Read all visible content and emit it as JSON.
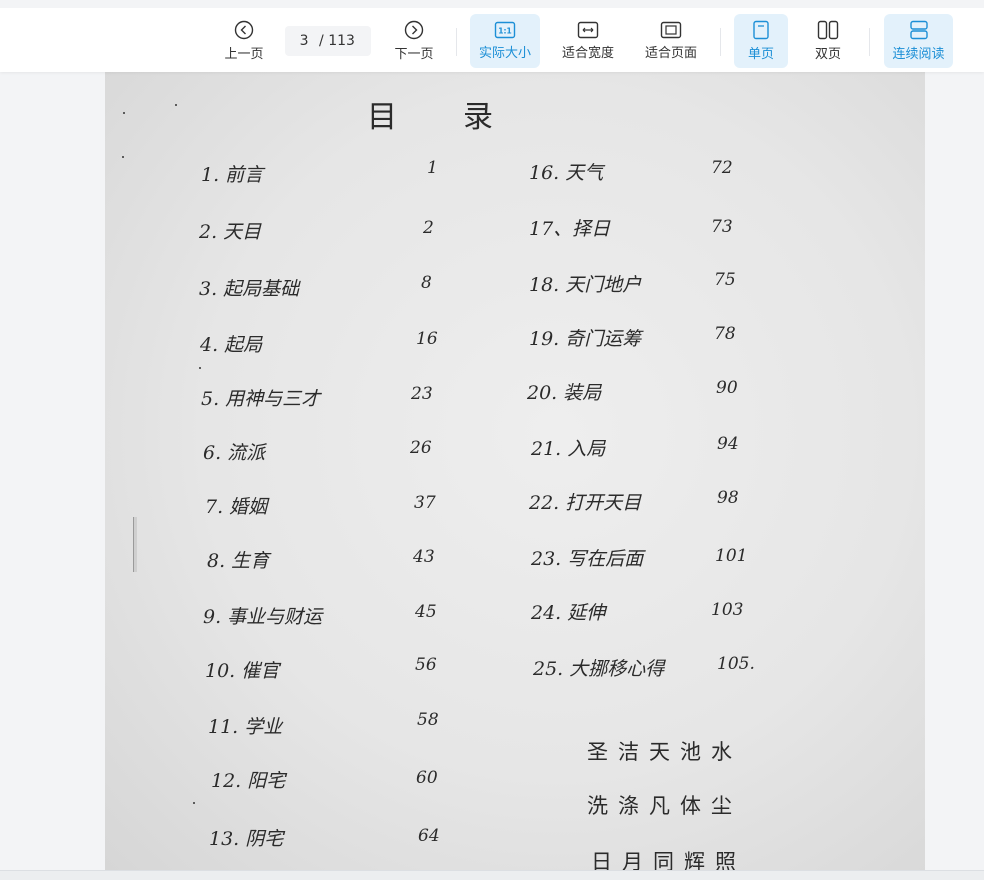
{
  "toolbar": {
    "prev_label": "上一页",
    "next_label": "下一页",
    "current_page": "3",
    "total_pages": "/ 113",
    "actual_size_label": "实际大小",
    "fit_width_label": "适合宽度",
    "fit_page_label": "适合页面",
    "single_page_label": "单页",
    "double_page_label": "双页",
    "continuous_label": "连续阅读",
    "active_color": "#1c8fd6",
    "active_bg": "#e3f1fb"
  },
  "document": {
    "title": "目　　录",
    "toc_left": [
      {
        "label": "1. 前言",
        "page": "1"
      },
      {
        "label": "2. 天目",
        "page": "2"
      },
      {
        "label": "3. 起局基础",
        "page": "8"
      },
      {
        "label": "4. 起局",
        "page": "16"
      },
      {
        "label": "5. 用神与三才",
        "page": "23"
      },
      {
        "label": "6. 流派",
        "page": "26"
      },
      {
        "label": "7. 婚姻",
        "page": "37"
      },
      {
        "label": "8. 生育",
        "page": "43"
      },
      {
        "label": "9. 事业与财运",
        "page": "45"
      },
      {
        "label": "10. 催官",
        "page": "56"
      },
      {
        "label": "11. 学业",
        "page": "58"
      },
      {
        "label": "12. 阳宅",
        "page": "60"
      },
      {
        "label": "13. 阴宅",
        "page": "64"
      }
    ],
    "toc_right": [
      {
        "label": "16. 天气",
        "page": "72"
      },
      {
        "label": "17、择日",
        "page": "73"
      },
      {
        "label": "18. 天门地户",
        "page": "75"
      },
      {
        "label": "19. 奇门运筹",
        "page": "78"
      },
      {
        "label": "20. 装局",
        "page": "90"
      },
      {
        "label": "21. 入局",
        "page": "94"
      },
      {
        "label": "22. 打开天目",
        "page": "98"
      },
      {
        "label": "23. 写在后面",
        "page": "101"
      },
      {
        "label": "24. 延伸",
        "page": "103"
      },
      {
        "label": "25. 大挪移心得",
        "page": "105."
      }
    ],
    "poem": [
      "圣洁天池水",
      "洗涤凡体尘",
      "日月同辉照"
    ]
  }
}
